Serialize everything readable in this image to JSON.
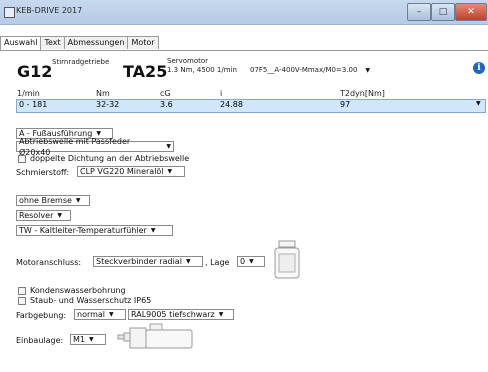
{
  "window": {
    "title": "KEB-DRIVE 2017"
  },
  "tabs": [
    {
      "label": "Auswahl"
    },
    {
      "label": "Text"
    },
    {
      "label": "Abmessungen"
    },
    {
      "label": "Motor"
    }
  ],
  "header": {
    "gear_code": "G12",
    "gear_desc": "Stirnradgetriebe",
    "motor_code": "TA25",
    "motor_desc_line1": "Servomotor",
    "motor_desc_line2": "1.3 Nm, 4500 1/min",
    "config_value": "07F5__A-400V-Mmax/M0=3.00"
  },
  "table": {
    "columns": [
      "1/min",
      "Nm",
      "cG",
      "i",
      "T2dyn[Nm]"
    ],
    "row": [
      "0 - 181",
      "32-32",
      "3.6",
      "24.88",
      "97"
    ]
  },
  "options": {
    "mounting": "A - Fußausführung",
    "shaft": "Abtriebswelle mit Passfeder Ø20x40",
    "double_seal_label": "doppelte Dichtung an der Abtriebswelle",
    "lubricant_label": "Schmierstoff:",
    "lubricant": "CLP VG220 Mineralöl",
    "brake": "ohne Bremse",
    "feedback": "Resolver",
    "sensor": "TW - Kaltleiter-Temperaturfühler",
    "motor_conn_label": "Motoranschluss:",
    "motor_conn": "Steckverbinder radial",
    "position_label": ", Lage",
    "position": "0",
    "condensate_label": "Kondenswasserbohrung",
    "ip65_label": "Staub- und Wasserschutz IP65",
    "paint_label": "Farbgebung:",
    "paint_type": "normal",
    "paint_color": "RAL9005 tiefschwarz",
    "install_label": "Einbaulage:",
    "install": "M1"
  }
}
